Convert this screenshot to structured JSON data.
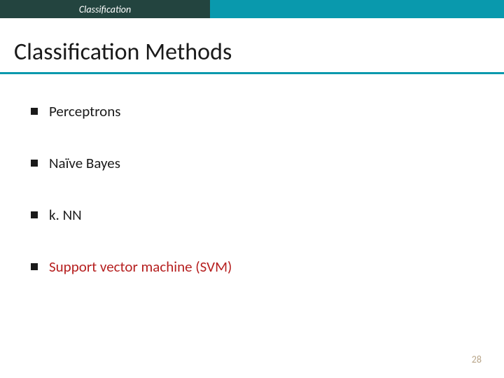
{
  "header": {
    "tab_label": "Classification"
  },
  "slide": {
    "title": "Classification Methods",
    "bullets": [
      {
        "text": "Perceptrons",
        "highlighted": false
      },
      {
        "text": "Naïve Bayes",
        "highlighted": false
      },
      {
        "text": "k. NN",
        "highlighted": false
      },
      {
        "text": "Support vector machine (SVM)",
        "highlighted": true
      }
    ],
    "page_number": "28"
  },
  "colors": {
    "accent_teal": "#0999ad",
    "tab_dark": "#23443f",
    "highlight_red": "#b62020"
  }
}
